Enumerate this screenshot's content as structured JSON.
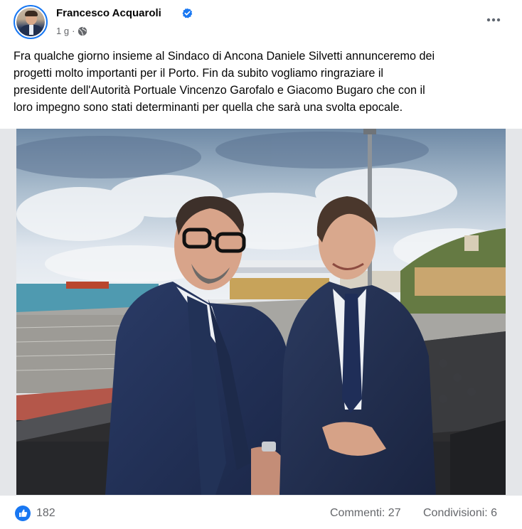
{
  "post": {
    "author": "Francesco Acquaroli",
    "time": "1 g",
    "time_separator": "·",
    "text_lines": [
      "Fra qualche giorno insieme al Sindaco di Ancona Daniele Silvetti annunceremo dei",
      "progetti molto importanti per il Porto. Fin da subito vogliamo ringraziare il",
      "presidente dell'Autorità Portuale Vincenzo Garofalo e Giacomo Bugaro che con il",
      "loro impegno sono stati determinanti per quella che sarà una svolta epocale."
    ]
  },
  "footer": {
    "likes": "182",
    "comments": "Commenti: 27",
    "shares": "Condivisioni: 6"
  },
  "icons": {
    "verified": "verified-badge-icon",
    "privacy": "globe-icon",
    "more": "more-options-icon",
    "like": "like-reaction-icon"
  },
  "colors": {
    "brand_blue": "#1877f2",
    "secondary_text": "#65676b",
    "primary_text": "#050505"
  }
}
